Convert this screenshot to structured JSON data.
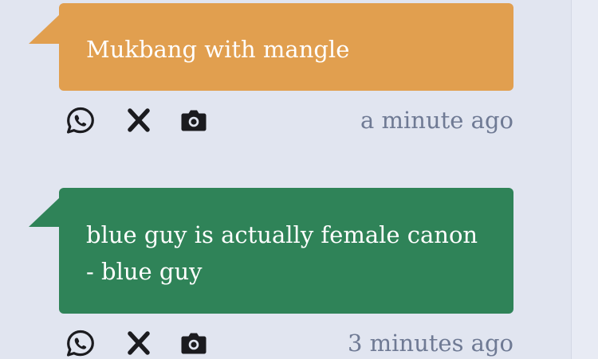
{
  "colors": {
    "background": "#e1e5f0",
    "bubble_orange": "#e19f4f",
    "bubble_green": "#2f8358",
    "icon": "#1b1b1f",
    "timestamp": "#6f7a94"
  },
  "messages": [
    {
      "text": "Mukbang with mangle",
      "color": "#e19f4f",
      "timestamp": "a minute ago",
      "actions": [
        "whatsapp-icon",
        "x-icon",
        "camera-icon"
      ]
    },
    {
      "text": "blue guy is actually female canon - blue guy",
      "color": "#2f8358",
      "timestamp": "3 minutes ago",
      "actions": [
        "whatsapp-icon",
        "x-icon",
        "camera-icon"
      ]
    }
  ]
}
